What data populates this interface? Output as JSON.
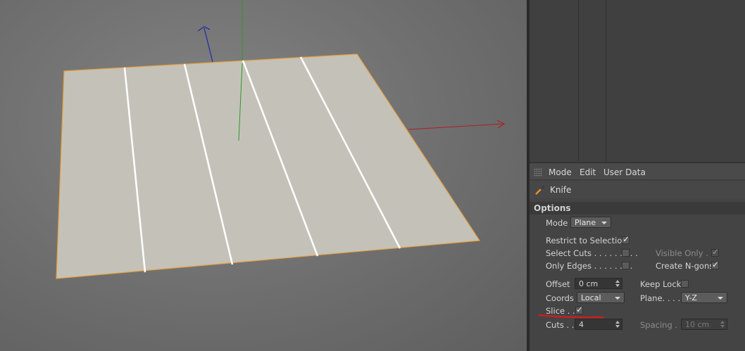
{
  "attribute_manager": {
    "menu": [
      {
        "label": "Mode"
      },
      {
        "label": "Edit"
      },
      {
        "label": "User Data"
      }
    ],
    "tool_name": "Knife",
    "section_title": "Options",
    "mode": {
      "label": "Mode",
      "value": "Plane"
    },
    "restrict_to_selection": {
      "label": "Restrict to Selection",
      "checked": true
    },
    "select_cuts": {
      "label": "Select Cuts . . . . . . . . .",
      "checked": false
    },
    "visible_only": {
      "label": "Visible Only . .",
      "checked": true,
      "disabled": true
    },
    "only_edges": {
      "label": "Only Edges . . . . . . . .",
      "checked": false
    },
    "create_ngons": {
      "label": "Create N-gons",
      "checked": true
    },
    "offset": {
      "label": "Offset",
      "value": "0 cm"
    },
    "keep_lock": {
      "label": "Keep Lock",
      "checked": false
    },
    "coords": {
      "label": "Coords",
      "value": "Local"
    },
    "plane": {
      "label": "Plane. . . . .",
      "value": "Y-Z"
    },
    "slice": {
      "label": "Slice . . .",
      "checked": true
    },
    "cuts": {
      "label": "Cuts . . .",
      "value": "4"
    },
    "spacing": {
      "label": "Spacing . . .",
      "value": "10 cm",
      "disabled": true
    }
  },
  "colors": {
    "plane_fill": "#c4c2b8",
    "selection_outline": "#e8a040",
    "cut_lines": "#ffffff",
    "axis_x": "#b02020",
    "axis_y": "#2a9a2a",
    "axis_z": "#2030a0",
    "annotation_underline": "#c82020"
  }
}
